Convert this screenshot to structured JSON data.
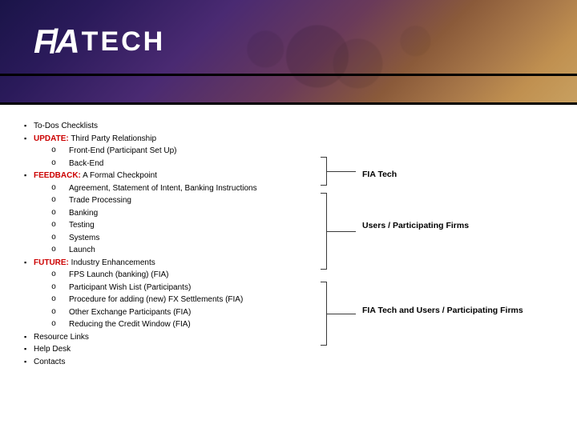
{
  "logo": {
    "fia": "FIA",
    "tech": "TECH"
  },
  "bullets": {
    "todos": "To-Dos Checklists",
    "update_label": "UPDATE:",
    "update_text": "Third Party Relationship",
    "update_items": {
      "a": "Front-End (Participant Set Up)",
      "b": "Back-End"
    },
    "feedback_label": "FEEDBACK:",
    "feedback_text": "A Formal Checkpoint",
    "feedback_items": {
      "a": "Agreement, Statement of Intent, Banking Instructions",
      "b": "Trade Processing",
      "c": "Banking",
      "d": "Testing",
      "e": "Systems",
      "f": "Launch"
    },
    "future_label": "FUTURE:",
    "future_text": "Industry Enhancements",
    "future_items": {
      "a": "FPS Launch (banking) (FIA)",
      "b": "Participant Wish List (Participants)",
      "c": "Procedure for adding (new) FX Settlements (FIA)",
      "d": "Other Exchange Participants (FIA)",
      "e": "Reducing the Credit Window (FIA)"
    },
    "resource": "Resource Links",
    "helpdesk": "Help Desk",
    "contacts": "Contacts"
  },
  "notes": {
    "n1": "FIA Tech",
    "n2": "Users / Participating Firms",
    "n3": "FIA Tech and Users / Participating Firms"
  }
}
